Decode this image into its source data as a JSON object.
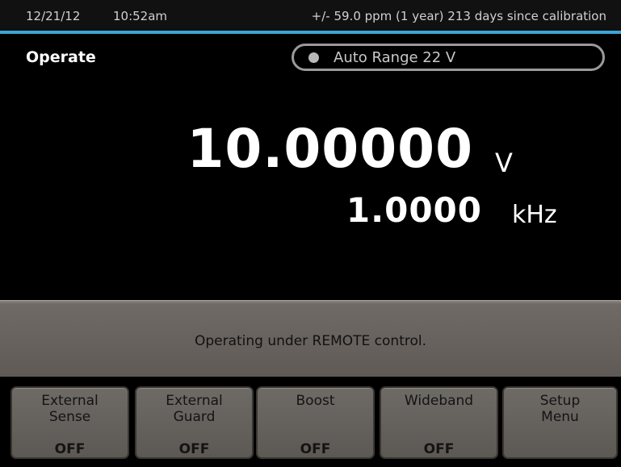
{
  "status_bar": {
    "date": "12/21/12",
    "time": "10:52am",
    "calibration": "+/- 59.0 ppm (1 year)  213 days since calibration",
    "accent_color": "#3aa6d8"
  },
  "header": {
    "mode": "Operate",
    "range": "Auto Range 22 V"
  },
  "readout": {
    "amplitude_value": "10.00000",
    "amplitude_unit": "V",
    "frequency_value": "1.0000",
    "frequency_unit": "kHz"
  },
  "message": "Operating under REMOTE control.",
  "softkeys": [
    {
      "line1": "External",
      "line2": "Sense",
      "state": "OFF"
    },
    {
      "line1": "External",
      "line2": "Guard",
      "state": "OFF"
    },
    {
      "line1": "Boost",
      "line2": "",
      "state": "OFF"
    },
    {
      "line1": "Wideband",
      "line2": "",
      "state": "OFF"
    },
    {
      "line1": "Setup",
      "line2": "Menu",
      "state": ""
    }
  ]
}
